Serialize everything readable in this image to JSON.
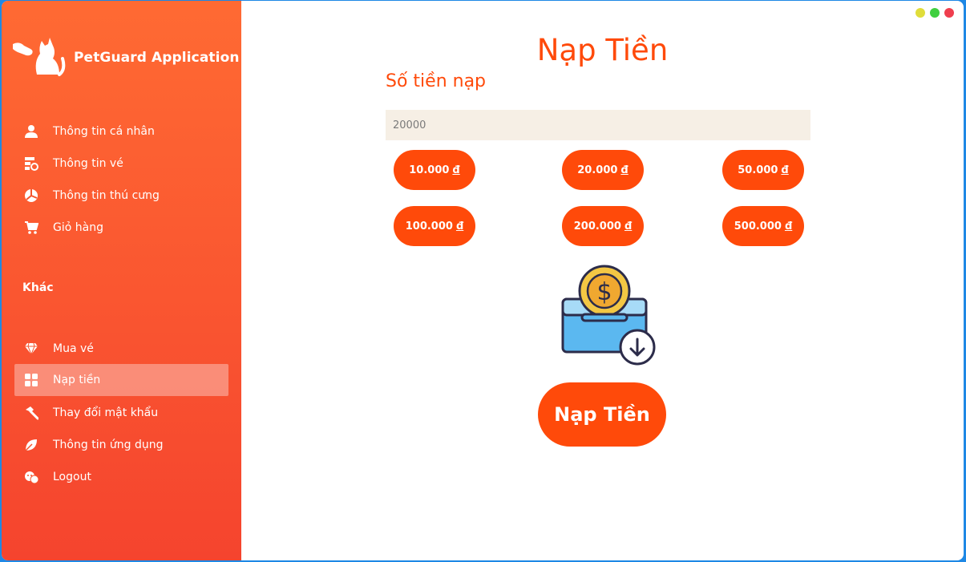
{
  "app": {
    "name": "PetGuard Application"
  },
  "window_controls": {
    "minimize_color": "#e0dd3a",
    "maximize_color": "#3fcf3f",
    "close_color": "#ef3e4e"
  },
  "sidebar": {
    "items": [
      {
        "label": "Thông tin cá nhân",
        "icon": "user-icon"
      },
      {
        "label": "Thông tin vé",
        "icon": "ticket-icon"
      },
      {
        "label": "Thông tin thú cưng",
        "icon": "pet-icon"
      },
      {
        "label": "Giỏ hàng",
        "icon": "cart-icon"
      }
    ],
    "section_title": "Khác",
    "other_items": [
      {
        "label": "Mua vé",
        "icon": "diamond-icon"
      },
      {
        "label": "Nạp tiền",
        "icon": "grid-icon",
        "active": true
      },
      {
        "label": "Thay đổi mật khẩu",
        "icon": "hammer-icon"
      },
      {
        "label": "Thông tin ứng dụng",
        "icon": "leaf-icon"
      },
      {
        "label": "Logout",
        "icon": "logout-icon"
      }
    ]
  },
  "main": {
    "title": "Nạp Tiền",
    "amount_label": "Số tiền nạp",
    "amount_value": "20000",
    "amount_buttons": [
      {
        "amount": "10.000",
        "currency": "đ"
      },
      {
        "amount": "20.000",
        "currency": "đ"
      },
      {
        "amount": "50.000",
        "currency": "đ"
      },
      {
        "amount": "100.000",
        "currency": "đ"
      },
      {
        "amount": "200.000",
        "currency": "đ"
      },
      {
        "amount": "500.000",
        "currency": "đ"
      }
    ],
    "illustration": "coin-deposit-icon",
    "submit_label": "Nạp Tiền"
  },
  "colors": {
    "accent": "#ff4a0a",
    "sidebar_top": "#ff6a33",
    "sidebar_bottom": "#f5442e",
    "input_bg": "#f6efe5"
  }
}
